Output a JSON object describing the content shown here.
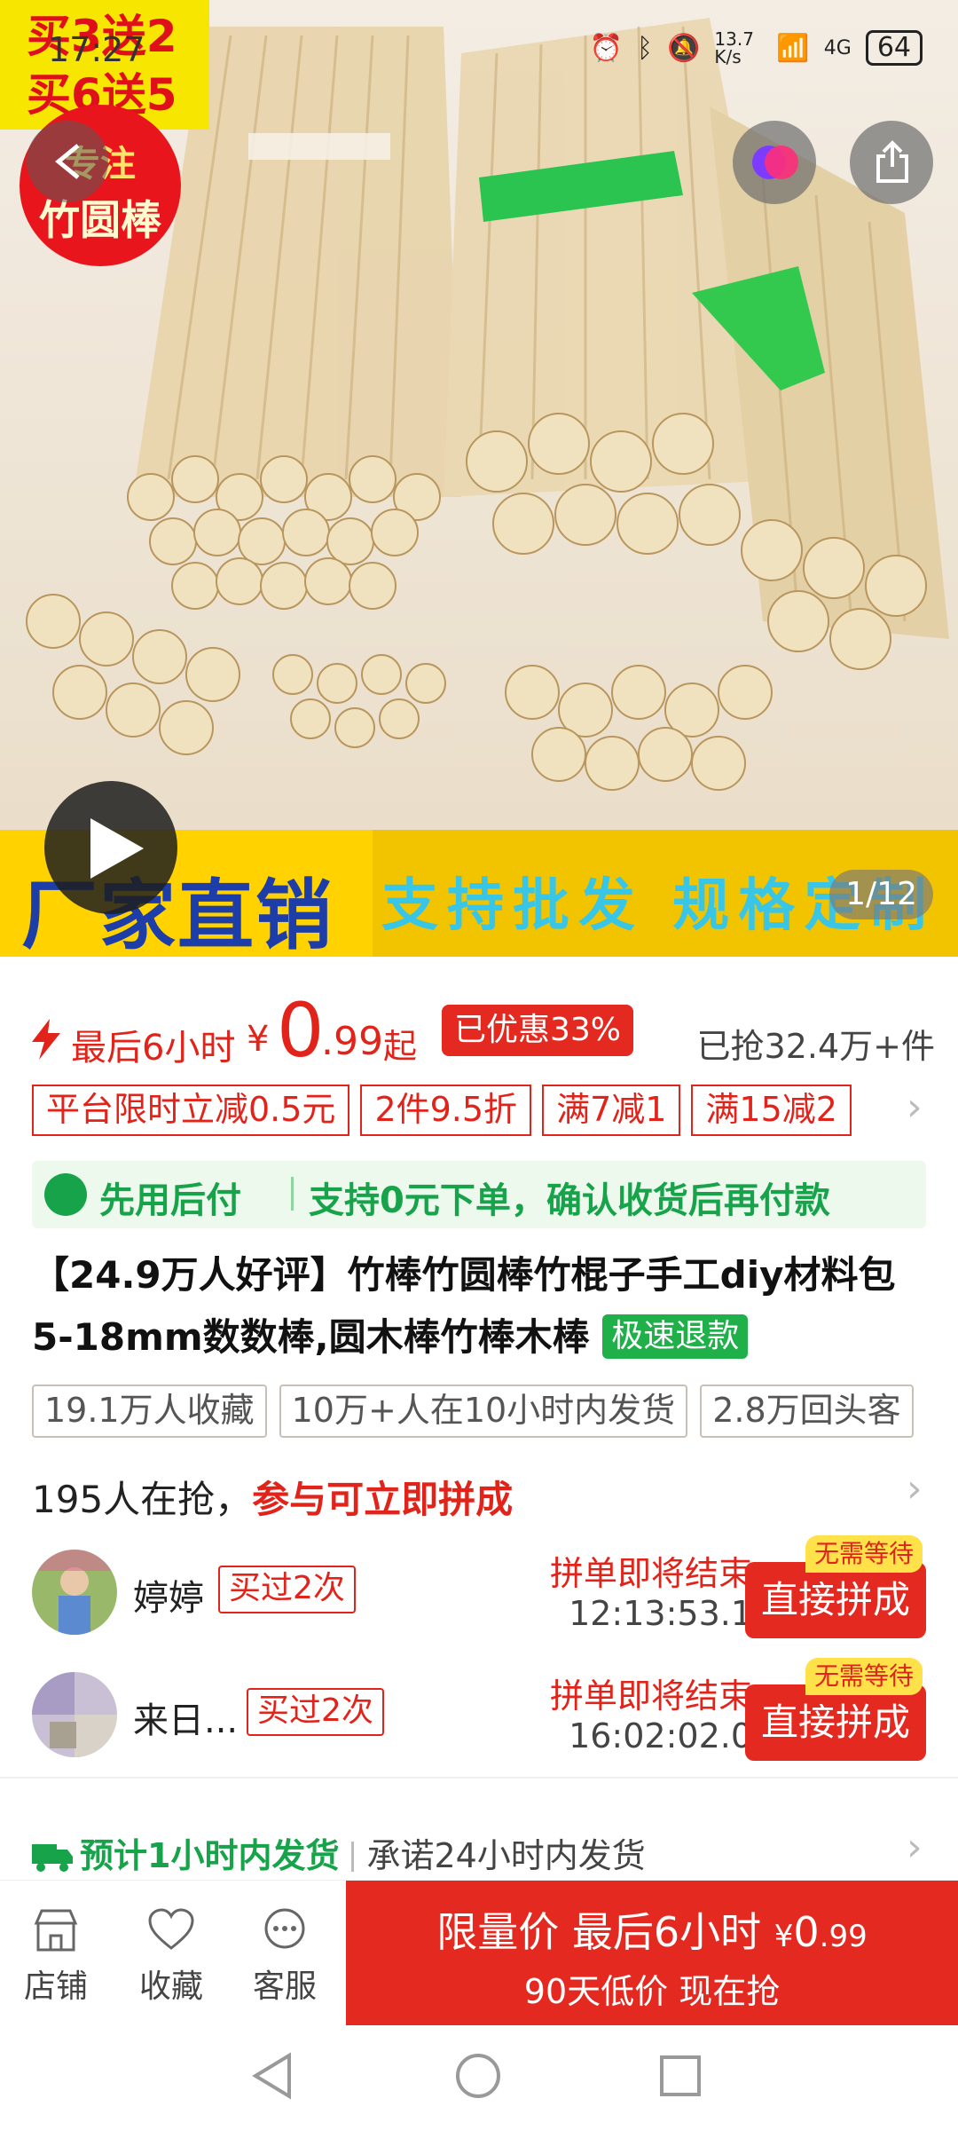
{
  "status": {
    "time": "17:27",
    "net_speed": "13.7 K/s",
    "network": "4G",
    "battery": "64"
  },
  "hero": {
    "promo_tag_1": "买3送2",
    "promo_tag_2": "买6送5",
    "badge_line1": "专注",
    "badge_line2": "竹圆棒",
    "banner_title": "厂家直销",
    "banner_sub": "支持批发 规格定制",
    "page_indicator": "1/12"
  },
  "price": {
    "limit_text": "最后6小时",
    "currency": "¥",
    "price_int": "0",
    "price_dec": ".99",
    "price_suffix": "起",
    "discount_badge": "已优惠33%",
    "sold": "已抢32.4万+件",
    "accent_color": "#e2231a"
  },
  "coupons": [
    "平台限时立减0.5元",
    "2件9.5折",
    "满7减1",
    "满15减2"
  ],
  "paylater": {
    "title": "先用后付",
    "desc": "支持0元下单，确认收货后再付款"
  },
  "product": {
    "title": "【24.9万人好评】竹棒竹圆棒竹棍子手工diy材料包5-18mm数数棒,圆木棒竹棒木棒",
    "refund_badge": "极速退款"
  },
  "tags": [
    "19.1万人收藏",
    "10万+人在10小时内发货",
    "2.8万回头客"
  ],
  "groupbuy": {
    "count_text": "195人在抢，",
    "cta_text": "参与可立即拼成",
    "rows": [
      {
        "name": "婷婷",
        "bought": "买过2次",
        "ending": "拼单即将结束",
        "countdown": "12:13:53.1",
        "no_wait": "无需等待",
        "button": "直接拼成"
      },
      {
        "name": "来日...",
        "bought": "买过2次",
        "ending": "拼单即将结束",
        "countdown": "16:02:02.0",
        "no_wait": "无需等待",
        "button": "直接拼成"
      }
    ]
  },
  "shipping": {
    "estimate": "预计1小时内发货",
    "promise": "承诺24小时内发货"
  },
  "action_bar": {
    "shop": "店铺",
    "favorite": "收藏",
    "service": "客服",
    "buy_line1_a": "限量价 最后6小时",
    "buy_line1_currency": "¥",
    "buy_line1_int": "0",
    "buy_line1_dec": ".99",
    "buy_line2": "90天低价 现在抢"
  }
}
